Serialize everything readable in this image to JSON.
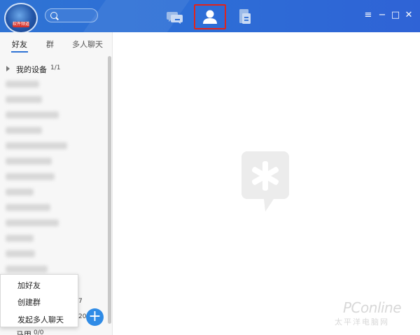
{
  "titlebar": {
    "avatar_text": "软件频道",
    "search_placeholder": "",
    "nav": [
      "chat-icon",
      "contacts-icon",
      "file-icon"
    ],
    "window_buttons": [
      "≡",
      "−",
      "□",
      "✕"
    ]
  },
  "tabs": [
    "好友",
    "群",
    "多人聊天"
  ],
  "groups": {
    "my_devices": {
      "name": "我的设备",
      "count": "1/1"
    },
    "partial_count_1": "7",
    "partial_count_2": "20/",
    "bottom": {
      "name": "马甲",
      "count": "0/0"
    }
  },
  "context_menu": [
    "加好友",
    "创建群",
    "发起多人聊天"
  ],
  "fab_label": "+",
  "watermark": {
    "line1": "PConline",
    "line2": "太平洋电脑网"
  },
  "colors": {
    "accent": "#2f73d4",
    "titlebar": "#2d6ed6",
    "highlight": "#e2231a"
  }
}
